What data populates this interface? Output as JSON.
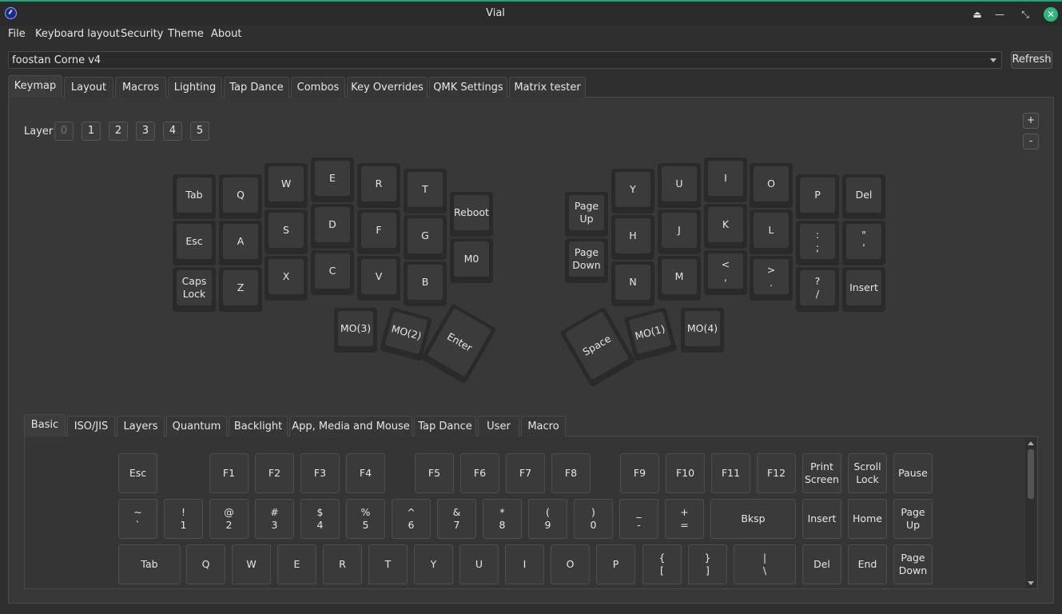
{
  "window": {
    "title": "Vial"
  },
  "menu": [
    "File",
    "Keyboard layout",
    "Security",
    "Theme",
    "About"
  ],
  "device": {
    "selected": "foostan Corne v4",
    "refresh_label": "Refresh"
  },
  "main_tabs": [
    "Keymap",
    "Layout",
    "Macros",
    "Lighting",
    "Tap Dance",
    "Combos",
    "Key Overrides",
    "QMK Settings",
    "Matrix tester"
  ],
  "layer": {
    "label": "Layer",
    "layers": [
      "0",
      "1",
      "2",
      "3",
      "4",
      "5"
    ],
    "selected": "0",
    "plus": "+",
    "minus": "-"
  },
  "keymap_keys": [
    "Tab",
    "Q",
    "W",
    "E",
    "R",
    "T",
    "Reboot",
    "Esc",
    "A",
    "S",
    "D",
    "F",
    "G",
    "M0",
    "Caps\nLock",
    "Z",
    "X",
    "C",
    "V",
    "B",
    "MO(3)",
    "MO(2)",
    "Enter",
    "Page\nUp",
    "Y",
    "U",
    "I",
    "O",
    "P",
    "Del",
    "Page\nDown",
    "H",
    "J",
    "K",
    "L",
    ":\n;",
    "\"\n'",
    "N",
    "M",
    "<\n,",
    ">\n.",
    "?\n/",
    "Insert",
    "Space",
    "MO(1)",
    "MO(4)"
  ],
  "picker_tabs": [
    "Basic",
    "ISO/JIS",
    "Layers",
    "Quantum",
    "Backlight",
    "App, Media and Mouse",
    "Tap Dance",
    "User",
    "Macro"
  ],
  "picker_keys": [
    "Esc",
    "F1",
    "F2",
    "F3",
    "F4",
    "F5",
    "F6",
    "F7",
    "F8",
    "F9",
    "F10",
    "F11",
    "F12",
    "Print\nScreen",
    "Scroll\nLock",
    "Pause",
    "~\n`",
    "!\n1",
    "@\n2",
    "#\n3",
    "$\n4",
    "%\n5",
    "^\n6",
    "&\n7",
    "*\n8",
    "(\n9",
    ")\n0",
    "_\n-",
    "+\n=",
    "Bksp",
    "Insert",
    "Home",
    "Page\nUp",
    "Tab",
    "Q",
    "W",
    "E",
    "R",
    "T",
    "Y",
    "U",
    "I",
    "O",
    "P",
    "{\n[",
    "}\n]",
    "|\n\\",
    "Del",
    "End",
    "Page\nDown"
  ]
}
